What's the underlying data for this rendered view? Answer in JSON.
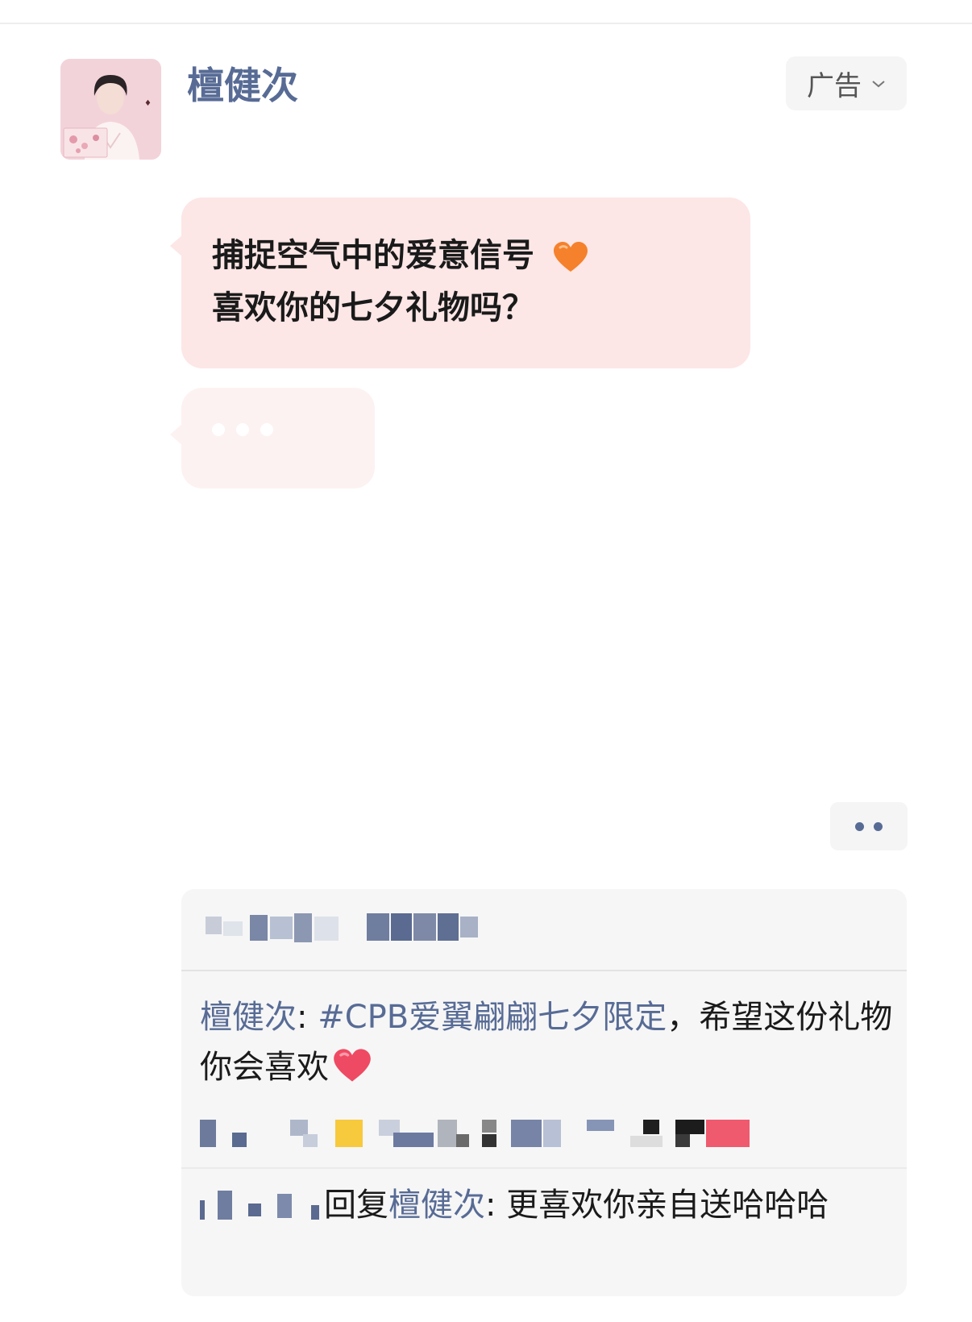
{
  "post": {
    "author": "檀健次",
    "ad_label": "广告",
    "bubble_line_1": "捕捉空气中的爱意信号",
    "bubble_line_2": "喜欢你的七夕礼物吗？"
  },
  "comments": [
    {
      "author": "檀健次",
      "separator": ": ",
      "hashtag": "#CPB爱翼翩翩七夕限定",
      "text": "，希望这份礼物你会喜欢"
    },
    {
      "reply_label": "回复",
      "reply_to": "檀健次",
      "separator": ": ",
      "text": "更喜欢你亲自送哈哈哈"
    }
  ],
  "icons": {
    "ad_chevron": "chevron-down-icon",
    "more": "more-dots-icon",
    "heart_orange": "orange-heart-emoji",
    "heart_red": "red-heart-emoji"
  },
  "colors": {
    "link": "#576b95",
    "bubble": "#fde6e6",
    "comment_bg": "#f6f6f6"
  }
}
